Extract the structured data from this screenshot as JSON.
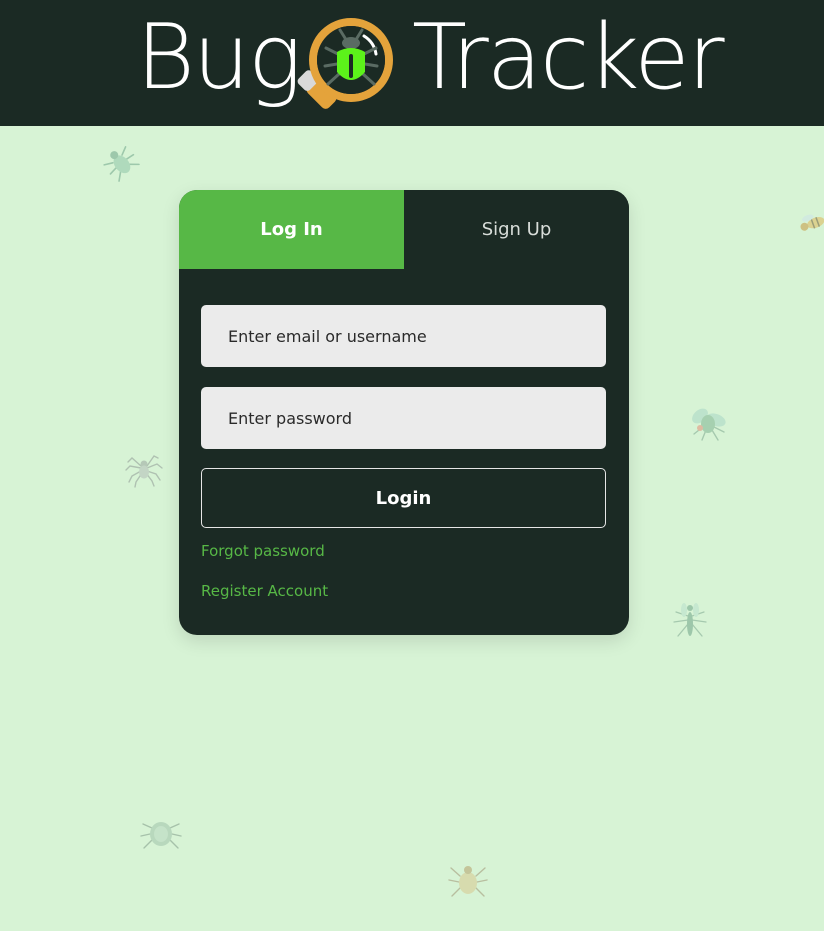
{
  "header": {
    "brand_left": "Bug",
    "brand_right": "Tracker",
    "logo_icon": "magnifier-bug-icon",
    "background_color": "#1b2a24"
  },
  "auth": {
    "tabs": [
      {
        "label": "Log In",
        "active": true
      },
      {
        "label": "Sign Up",
        "active": false
      }
    ],
    "email_placeholder": "Enter email or username",
    "password_placeholder": "Enter password",
    "submit_label": "Login",
    "forgot_link": "Forgot password",
    "register_link": "Register Account"
  },
  "colors": {
    "accent": "#57b846",
    "card_bg": "#1b2a24",
    "page_bg": "#d7f3d5",
    "input_bg": "#ebebeb",
    "logo_ring": "#e4a33b"
  },
  "decorations": {
    "icons": [
      "beetle-icon",
      "wasp-icon",
      "fly-icon",
      "spider-icon",
      "mosquito-icon",
      "aphid-icon",
      "tick-icon"
    ]
  }
}
